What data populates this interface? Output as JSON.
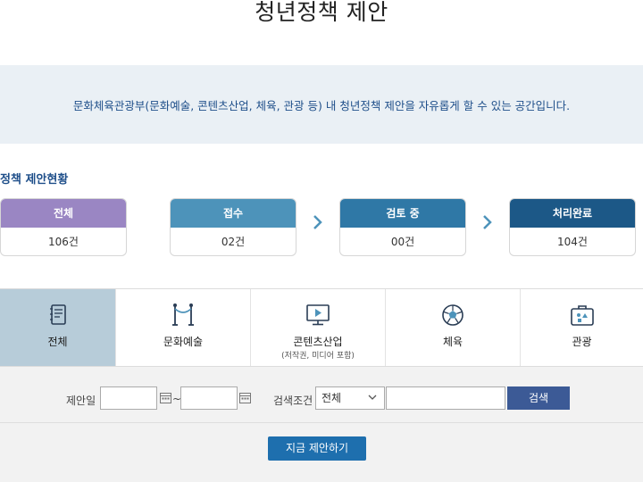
{
  "page_title": "청년정책 제안",
  "intro": "문화체육관광부(문화예술, 콘텐츠산업, 체육, 관광 등) 내 청년정책 제안을 자유롭게 할 수 있는 공간입니다.",
  "status": {
    "heading": "정책 제안현황",
    "cards": [
      {
        "label": "전체",
        "value": "106건",
        "color": "#9a86c3"
      },
      {
        "label": "접수",
        "value": "02건",
        "color": "#4d93ba"
      },
      {
        "label": "검토 중",
        "value": "00건",
        "color": "#2f78a6"
      },
      {
        "label": "처리완료",
        "value": "104건",
        "color": "#1c5887"
      }
    ]
  },
  "categories": [
    {
      "label": "전체",
      "icon": "notebook-icon"
    },
    {
      "label": "문화예술",
      "icon": "stanchion-icon"
    },
    {
      "label": "콘텐츠산업",
      "sub": "(저작권, 미디어 포함)",
      "icon": "monitor-play-icon"
    },
    {
      "label": "체육",
      "icon": "soccer-ball-icon"
    },
    {
      "label": "관광",
      "icon": "suitcase-icon"
    }
  ],
  "search": {
    "date_label": "제안일",
    "tilde": "~",
    "condition_label": "검색조건",
    "condition_value": "전체",
    "button": "검색"
  },
  "propose_button": "지금 제안하기"
}
